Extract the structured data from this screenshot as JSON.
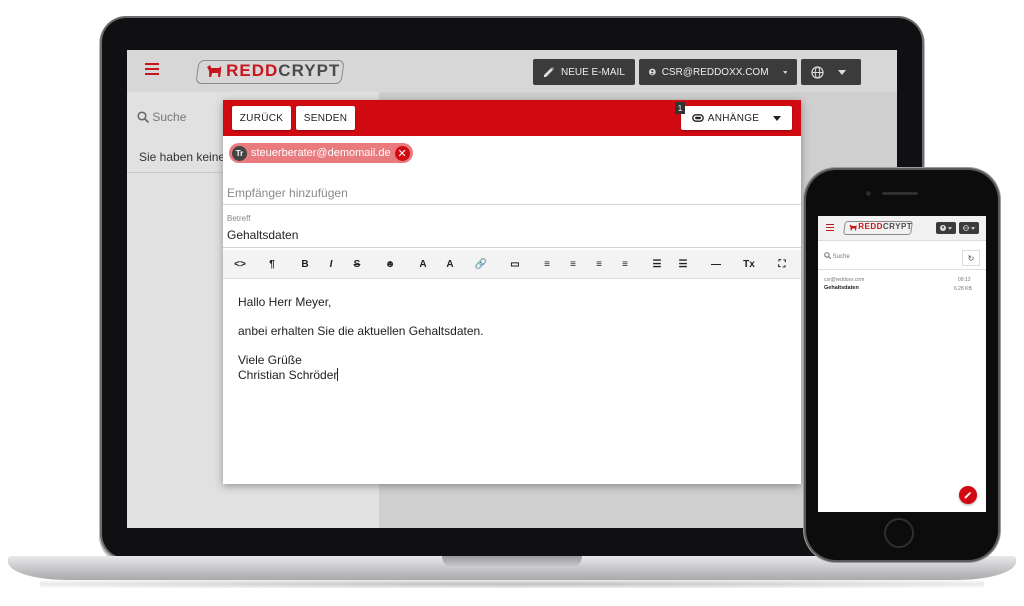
{
  "laptop": {
    "logo_text_red": "REDD",
    "logo_text_grey": "CRYPT",
    "new_email_label": "NEUE E-MAIL",
    "account_label": "CSR@REDDOXX.COM",
    "search_placeholder": "Suche",
    "empty_text": "Sie haben keine E",
    "compose": {
      "back_label": "ZURÜCK",
      "send_label": "SENDEN",
      "attachments_label": "ANHÄNGE",
      "attachments_count": "1",
      "recipient_initials": "Tr",
      "recipient_email": "steuerberater@demomail.de",
      "add_recipient_placeholder": "Empfänger hinzufügen",
      "subject_label": "Betreff",
      "subject_value": "Gehaltsdaten",
      "body": {
        "line1": "Hallo Herr Meyer,",
        "line2": "anbei erhalten Sie die aktuellen Gehaltsdaten.",
        "line3": "Viele Grüße",
        "line4": "Christian Schröder"
      },
      "toolbar": [
        "<>",
        "¶",
        "B",
        "I",
        "S",
        "☻",
        "A",
        "A",
        "🔗",
        "▭",
        "≡",
        "≡",
        "≡",
        "≡",
        "☰",
        "☰",
        "—",
        "Tx",
        "⛶"
      ]
    }
  },
  "phone": {
    "logo_text_red": "REDD",
    "logo_text_grey": "CRYPT",
    "search_placeholder": "Suche",
    "message": {
      "sender": "csr@reddoxx.com",
      "time": "09:12",
      "subject": "Gehaltsdaten",
      "size": "6.28 KB"
    }
  },
  "colors": {
    "brand_red": "#d10a12",
    "dark_button": "#3b3b3b"
  }
}
